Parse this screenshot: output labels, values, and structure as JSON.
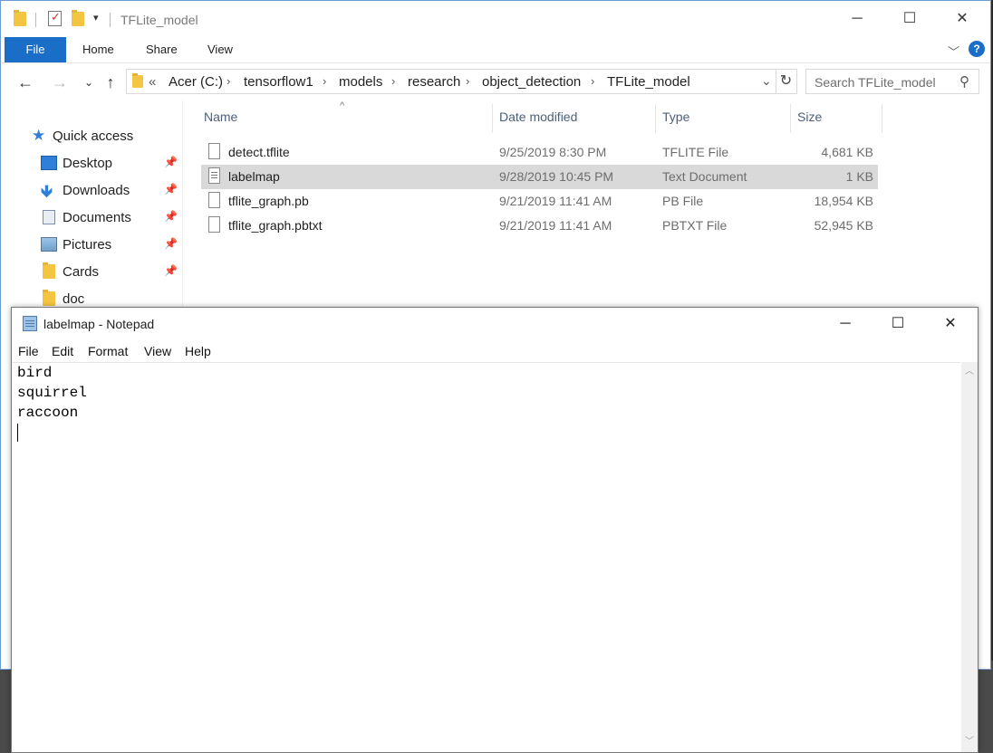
{
  "explorer": {
    "window_title": "TFLite_model",
    "ribbon_tabs": [
      "File",
      "Home",
      "Share",
      "View"
    ],
    "help_label": "?",
    "breadcrumb_prefix": "«",
    "breadcrumbs": [
      "Acer (C:)",
      "tensorflow1",
      "models",
      "research",
      "object_detection",
      "TFLite_model"
    ],
    "search_placeholder": "Search TFLite_model",
    "nav_items": [
      {
        "label": "Quick access",
        "icon": "star-icon"
      },
      {
        "label": "Desktop",
        "icon": "desktop-icon",
        "pinned": true
      },
      {
        "label": "Downloads",
        "icon": "download-arrow-icon",
        "pinned": true
      },
      {
        "label": "Documents",
        "icon": "documents-icon",
        "pinned": true
      },
      {
        "label": "Pictures",
        "icon": "pictures-icon",
        "pinned": true
      },
      {
        "label": "Cards",
        "icon": "folder-icon",
        "pinned": true
      },
      {
        "label": "doc",
        "icon": "folder-icon",
        "pinned": false
      }
    ],
    "columns": {
      "name": "Name",
      "date": "Date modified",
      "type": "Type",
      "size": "Size"
    },
    "files": [
      {
        "name": "detect.tflite",
        "date": "9/25/2019 8:30 PM",
        "type": "TFLITE File",
        "size": "4,681 KB",
        "selected": false
      },
      {
        "name": "labelmap",
        "date": "9/28/2019 10:45 PM",
        "type": "Text Document",
        "size": "1 KB",
        "selected": true
      },
      {
        "name": "tflite_graph.pb",
        "date": "9/21/2019 11:41 AM",
        "type": "PB File",
        "size": "18,954 KB",
        "selected": false
      },
      {
        "name": "tflite_graph.pbtxt",
        "date": "9/21/2019 11:41 AM",
        "type": "PBTXT File",
        "size": "52,945 KB",
        "selected": false
      }
    ]
  },
  "notepad": {
    "title": "labelmap - Notepad",
    "menu": [
      "File",
      "Edit",
      "Format",
      "View",
      "Help"
    ],
    "lines": [
      "bird",
      "squirrel",
      "raccoon"
    ]
  },
  "colors": {
    "accent": "#1a6ec7",
    "selection": "#d9d9d9",
    "folder": "#f4c542"
  }
}
